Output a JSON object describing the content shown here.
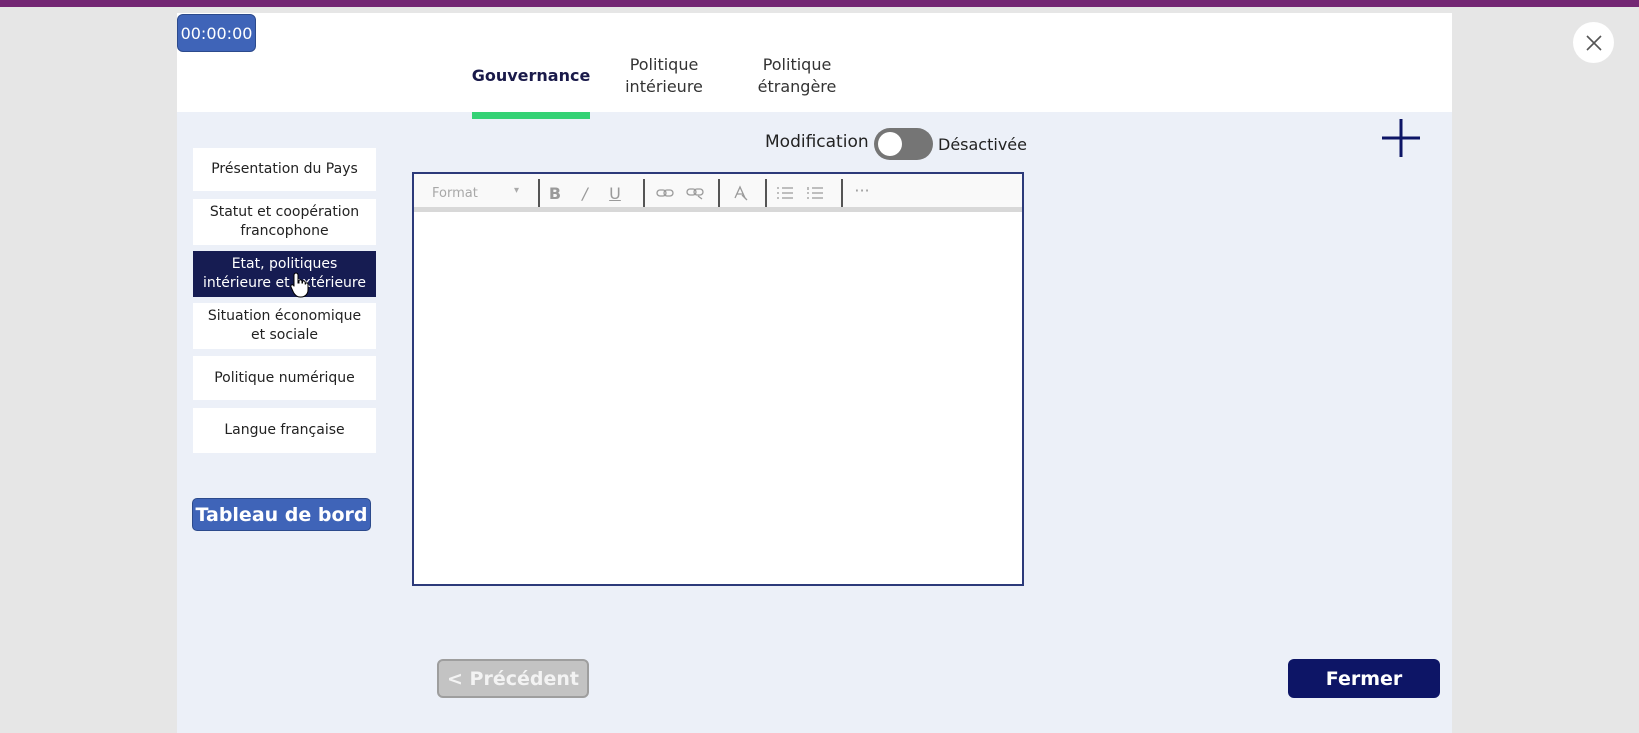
{
  "timer": {
    "value": "00:00:00"
  },
  "tabs": [
    {
      "label": "Gouvernance",
      "active": true
    },
    {
      "label": "Politique intérieure",
      "active": false
    },
    {
      "label": "Politique étrangère",
      "active": false
    }
  ],
  "sidebar": {
    "items": [
      {
        "label": "Présentation du Pays"
      },
      {
        "label": "Statut et coopération francophone"
      },
      {
        "label": "Etat, politiques intérieure et extérieure",
        "selected": true
      },
      {
        "label": "Situation économique et sociale"
      },
      {
        "label": "Politique numérique"
      },
      {
        "label": "Langue française"
      }
    ],
    "dashboard_label": "Tableau de bord"
  },
  "edit_mode": {
    "label": "Modification",
    "state_label": "Désactivée",
    "enabled": false
  },
  "editor": {
    "format_label": "Format",
    "content": ""
  },
  "footer": {
    "prev_label": "< Précédent",
    "close_label": "Fermer"
  },
  "colors": {
    "top_bar": "#742774",
    "primary_blue": "#3f64b8",
    "navy": "#0d1566",
    "selected_item": "#161c52",
    "tab_underline": "#34d275",
    "toggle_off": "#757575",
    "disabled": "#c3c3c3"
  }
}
